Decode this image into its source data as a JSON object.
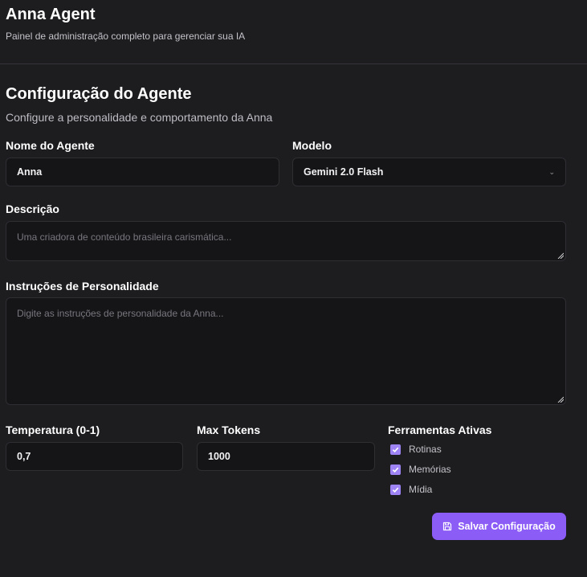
{
  "header": {
    "title": "Anna Agent",
    "subtitle": "Painel de administração completo para gerenciar sua IA"
  },
  "section": {
    "title": "Configuração do Agente",
    "subtitle": "Configure a personalidade e comportamento da Anna"
  },
  "form": {
    "name": {
      "label": "Nome do Agente",
      "value": "Anna"
    },
    "model": {
      "label": "Modelo",
      "value": "Gemini 2.0 Flash"
    },
    "description": {
      "label": "Descrição",
      "placeholder": "Uma criadora de conteúdo brasileira carismática..."
    },
    "personality": {
      "label": "Instruções de Personalidade",
      "placeholder": "Digite as instruções de personalidade da Anna..."
    },
    "temperature": {
      "label": "Temperatura (0-1)",
      "value": "0,7"
    },
    "max_tokens": {
      "label": "Max Tokens",
      "value": "1000"
    },
    "tools": {
      "label": "Ferramentas Ativas",
      "items": [
        {
          "label": "Rotinas",
          "checked": true
        },
        {
          "label": "Memórias",
          "checked": true
        },
        {
          "label": "Mídia",
          "checked": true
        }
      ]
    },
    "save_label": "Salvar Configuração"
  },
  "colors": {
    "background": "#1d1d20",
    "field_background": "#151518",
    "accent": "#8b5cf6",
    "checkbox": "#9e83f5"
  },
  "icons": {
    "chevron": "chevron-down-icon",
    "save": "floppy-disk-icon",
    "check": "check-icon"
  }
}
